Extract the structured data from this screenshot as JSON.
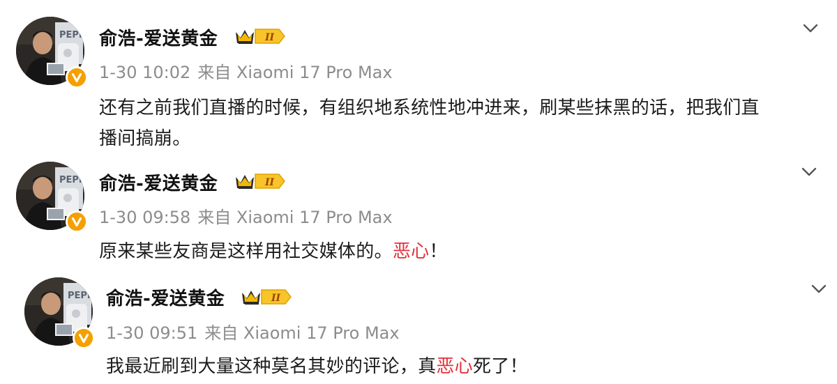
{
  "colors": {
    "username": "#111111",
    "meta": "#8c8c8c",
    "body_text": "#1c1c1c",
    "highlight": "#e3303a",
    "verified_badge": "#f5a000",
    "vip_badge": "#f2c000"
  },
  "posts": [
    {
      "username": "俞浩-爱送黄金",
      "time": "1-30 10:02",
      "source_prefix": "来自",
      "device": "Xiaomi 17 Pro Max",
      "text_line1": "还有之前我们直播的时候，有组织地系统性地冲进来，刷某些抹黑的话，把我们直",
      "text_line2": "播间搞崩。",
      "badge_level": "II",
      "avatar_icon": "user-avatar-photo",
      "menu_icon": "chevron-down-icon"
    },
    {
      "username": "俞浩-爱送黄金",
      "time": "1-30 09:58",
      "source_prefix": "来自",
      "device": "Xiaomi 17 Pro Max",
      "text_before": "原来某些友商是这样用社交媒体的。",
      "text_highlight": "恶心",
      "text_after": "！",
      "badge_level": "II",
      "avatar_icon": "user-avatar-photo",
      "menu_icon": "chevron-down-icon"
    },
    {
      "username": "俞浩-爱送黄金",
      "time": "1-30 09:51",
      "source_prefix": "来自",
      "device": "Xiaomi 17 Pro Max",
      "text_before": "我最近刷到大量这种莫名其妙的评论，真",
      "text_highlight": "恶心",
      "text_after": "死了！",
      "badge_level": "II",
      "avatar_icon": "user-avatar-photo",
      "menu_icon": "chevron-down-icon"
    }
  ]
}
